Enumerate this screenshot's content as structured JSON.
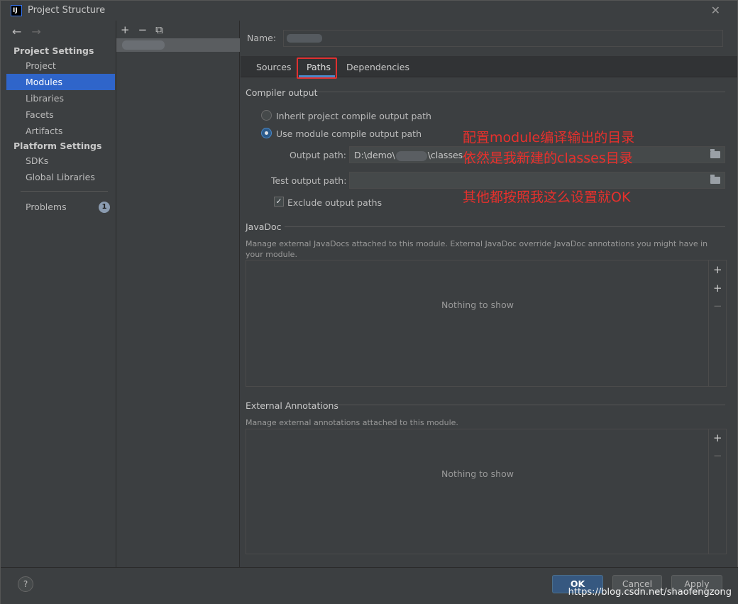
{
  "window": {
    "title": "Project Structure",
    "logo": "IJ"
  },
  "nav": {
    "back_icon": "←",
    "forward_icon": "→"
  },
  "left": {
    "project_settings_heading": "Project Settings",
    "project_items": [
      "Project",
      "Modules",
      "Libraries",
      "Facets",
      "Artifacts"
    ],
    "platform_settings_heading": "Platform Settings",
    "platform_items": [
      "SDKs",
      "Global Libraries"
    ],
    "problems_label": "Problems",
    "problems_count": "1"
  },
  "middle": {
    "add_icon": "+",
    "remove_icon": "−",
    "copy_icon": "⧉"
  },
  "name": {
    "label": "Name:"
  },
  "tabs": [
    "Sources",
    "Paths",
    "Dependencies"
  ],
  "compiler": {
    "title": "Compiler output",
    "inherit_label": "Inherit project compile output path",
    "use_module_label": "Use module compile output path",
    "output_label": "Output path:",
    "output_prefix": "D:\\demo\\",
    "output_suffix": "\\classes",
    "test_label": "Test output path:",
    "exclude_label": "Exclude output paths",
    "check_mark": "✓"
  },
  "annotations": {
    "line1": "配置module编译输出的目录",
    "line2": "依然是我新建的classes目录",
    "line3": "其他都按照我这么设置就OK"
  },
  "javadoc": {
    "title": "JavaDoc",
    "desc": "Manage external JavaDocs attached to this module. External JavaDoc override JavaDoc annotations you might have in your module.",
    "empty": "Nothing to show",
    "add_icon": "+",
    "add_url_icon": "+",
    "remove_icon": "−"
  },
  "ext_annotations": {
    "title": "External Annotations",
    "desc": "Manage external annotations attached to this module.",
    "empty": "Nothing to show",
    "add_icon": "+",
    "remove_icon": "−"
  },
  "footer": {
    "help": "?",
    "ok": "OK",
    "cancel": "Cancel",
    "apply": "Apply",
    "watermark": "https://blog.csdn.net/shaofengzong"
  },
  "colors": {
    "accent": "#2f65ca",
    "annotation": "#e8302c",
    "background": "#3c3f41"
  }
}
